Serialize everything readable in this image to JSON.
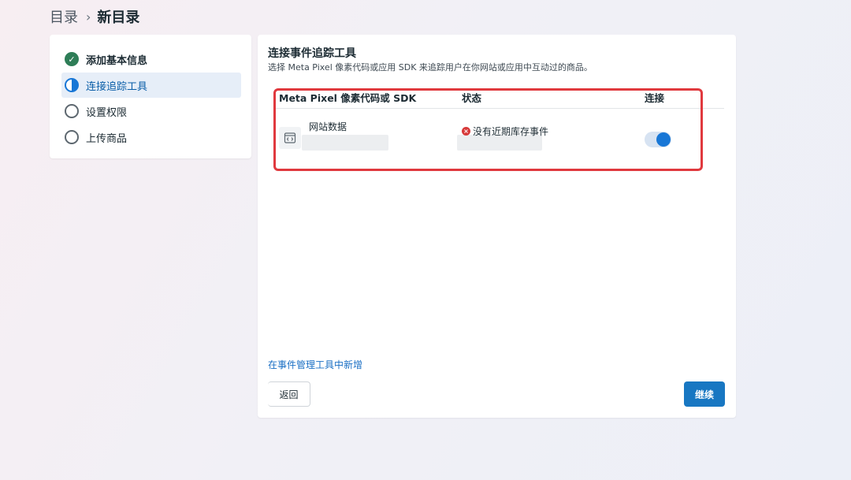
{
  "breadcrumb": {
    "parent": "目录",
    "separator": "›",
    "current": "新目录"
  },
  "steps": [
    {
      "label": "添加基本信息",
      "state": "done",
      "icon": "check-circle-icon"
    },
    {
      "label": "连接追踪工具",
      "state": "active",
      "icon": "half-circle-icon"
    },
    {
      "label": "设置权限",
      "state": "pending",
      "icon": "empty-circle-icon"
    },
    {
      "label": "上传商品",
      "state": "pending",
      "icon": "empty-circle-icon"
    }
  ],
  "main": {
    "title": "连接事件追踪工具",
    "description": "选择 Meta Pixel 像素代码或应用 SDK 来追踪用户在你网站或应用中互动过的商品。",
    "table": {
      "headers": {
        "source": "Meta Pixel 像素代码或 SDK",
        "status": "状态",
        "connect": "连接"
      },
      "rows": [
        {
          "source_name": "网站数据",
          "source_icon": "code-window-icon",
          "status": "没有近期库存事件",
          "status_icon": "error-dot-icon",
          "connected": true
        }
      ]
    },
    "add_link": "在事件管理工具中新增",
    "back_label": "返回",
    "continue_label": "继续"
  },
  "colors": {
    "accent": "#1877d6",
    "success": "#2e7d57",
    "error": "#d73a3a",
    "highlight": "#e0393e"
  }
}
